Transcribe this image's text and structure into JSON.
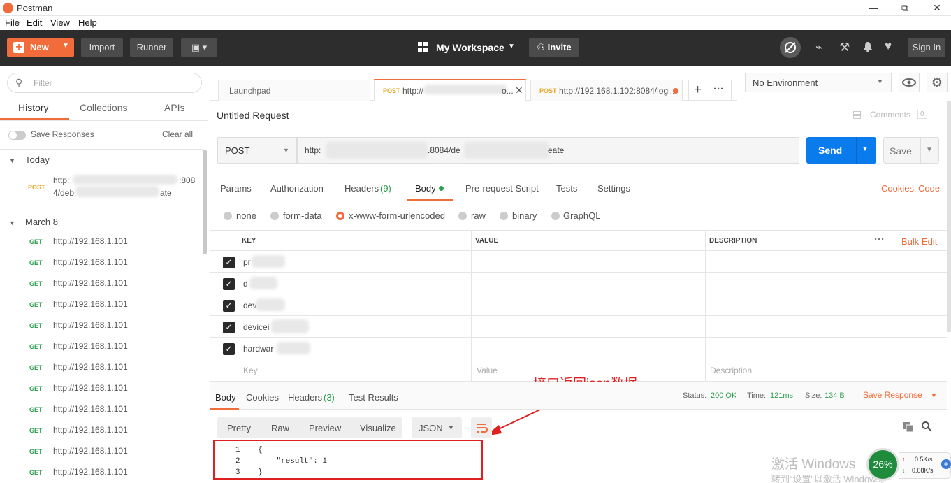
{
  "window": {
    "title": "Postman",
    "min": "—",
    "restore": "⧉",
    "close": "✕"
  },
  "menu": [
    "File",
    "Edit",
    "View",
    "Help"
  ],
  "header": {
    "new_label": "New",
    "import_label": "Import",
    "runner_label": "Runner",
    "workspace_label": "My Workspace",
    "invite_label": "Invite",
    "signin_label": "Sign In"
  },
  "sidebar": {
    "filter_placeholder": "Filter",
    "tabs": [
      "History",
      "Collections",
      "APIs"
    ],
    "save_responses": "Save Responses",
    "clear_all": "Clear all",
    "groups": [
      {
        "label": "Today",
        "items": [
          {
            "method": "POST",
            "url_line1": "http:",
            "url_suffix1": ":808",
            "url_line2": "4/deb",
            "url_suffix2": "ate"
          }
        ]
      },
      {
        "label": "March 8",
        "items": [
          {
            "method": "GET",
            "url": "http://192.168.1.101"
          },
          {
            "method": "GET",
            "url": "http://192.168.1.101"
          },
          {
            "method": "GET",
            "url": "http://192.168.1.101"
          },
          {
            "method": "GET",
            "url": "http://192.168.1.101"
          },
          {
            "method": "GET",
            "url": "http://192.168.1.101"
          },
          {
            "method": "GET",
            "url": "http://192.168.1.101"
          },
          {
            "method": "GET",
            "url": "http://192.168.1.101"
          },
          {
            "method": "GET",
            "url": "http://192.168.1.101"
          },
          {
            "method": "GET",
            "url": "http://192.168.1.101"
          },
          {
            "method": "GET",
            "url": "http://192.168.1.101"
          },
          {
            "method": "GET",
            "url": "http://192.168.1.101"
          },
          {
            "method": "GET",
            "url": "http://192.168.1.101"
          }
        ]
      }
    ]
  },
  "tabs": [
    {
      "label": "Launchpad"
    },
    {
      "method": "POST",
      "label": "http://",
      "suffix": "o..."
    },
    {
      "method": "POST",
      "label": "http://192.168.1.102:8084/logi..."
    }
  ],
  "environment": {
    "selected": "No Environment"
  },
  "request": {
    "title": "Untitled Request",
    "comments_label": "Comments",
    "comments_count": "0",
    "method": "POST",
    "url_start": "http:",
    "url_mid": ".8084/de",
    "url_end": "eate",
    "send_label": "Send",
    "save_label": "Save",
    "subtabs": [
      "Params",
      "Authorization",
      "Headers",
      "Body",
      "Pre-request Script",
      "Tests",
      "Settings"
    ],
    "headers_count": "(9)",
    "cookies_label": "Cookies",
    "code_label": "Code",
    "body_types": [
      "none",
      "form-data",
      "x-www-form-urlencoded",
      "raw",
      "binary",
      "GraphQL"
    ],
    "table": {
      "headers": [
        "KEY",
        "VALUE",
        "DESCRIPTION"
      ],
      "bulk_edit": "Bulk Edit",
      "rows": [
        "pr",
        "d",
        "dev",
        "devicei",
        "hardwar"
      ],
      "placeholders": [
        "Key",
        "Value",
        "Description"
      ]
    }
  },
  "response": {
    "tabs": [
      "Body",
      "Cookies",
      "Headers",
      "Test Results"
    ],
    "headers_count": "(3)",
    "status_label": "Status:",
    "status_value": "200 OK",
    "time_label": "Time:",
    "time_value": "121ms",
    "size_label": "Size:",
    "size_value": "134 B",
    "save_response": "Save Response",
    "views": [
      "Pretty",
      "Raw",
      "Preview",
      "Visualize"
    ],
    "format": "JSON",
    "code_lines": [
      {
        "n": "1",
        "text": "{"
      },
      {
        "n": "2",
        "text": "    \"result\": 1"
      },
      {
        "n": "3",
        "text": "}"
      }
    ]
  },
  "annotation": {
    "text": "接口返回json数据",
    "color": "#e02020"
  },
  "overlay": {
    "activate_line1": "激活 Windows",
    "activate_line2": "转到“设置”以激活 Windows。",
    "cpu": "26%",
    "up": "0.5K/s",
    "down": "0.08K/s"
  },
  "colors": {
    "accent": "#f26b3a",
    "send": "#097bed",
    "get": "#2e9f4f",
    "post": "#e8a31b"
  }
}
